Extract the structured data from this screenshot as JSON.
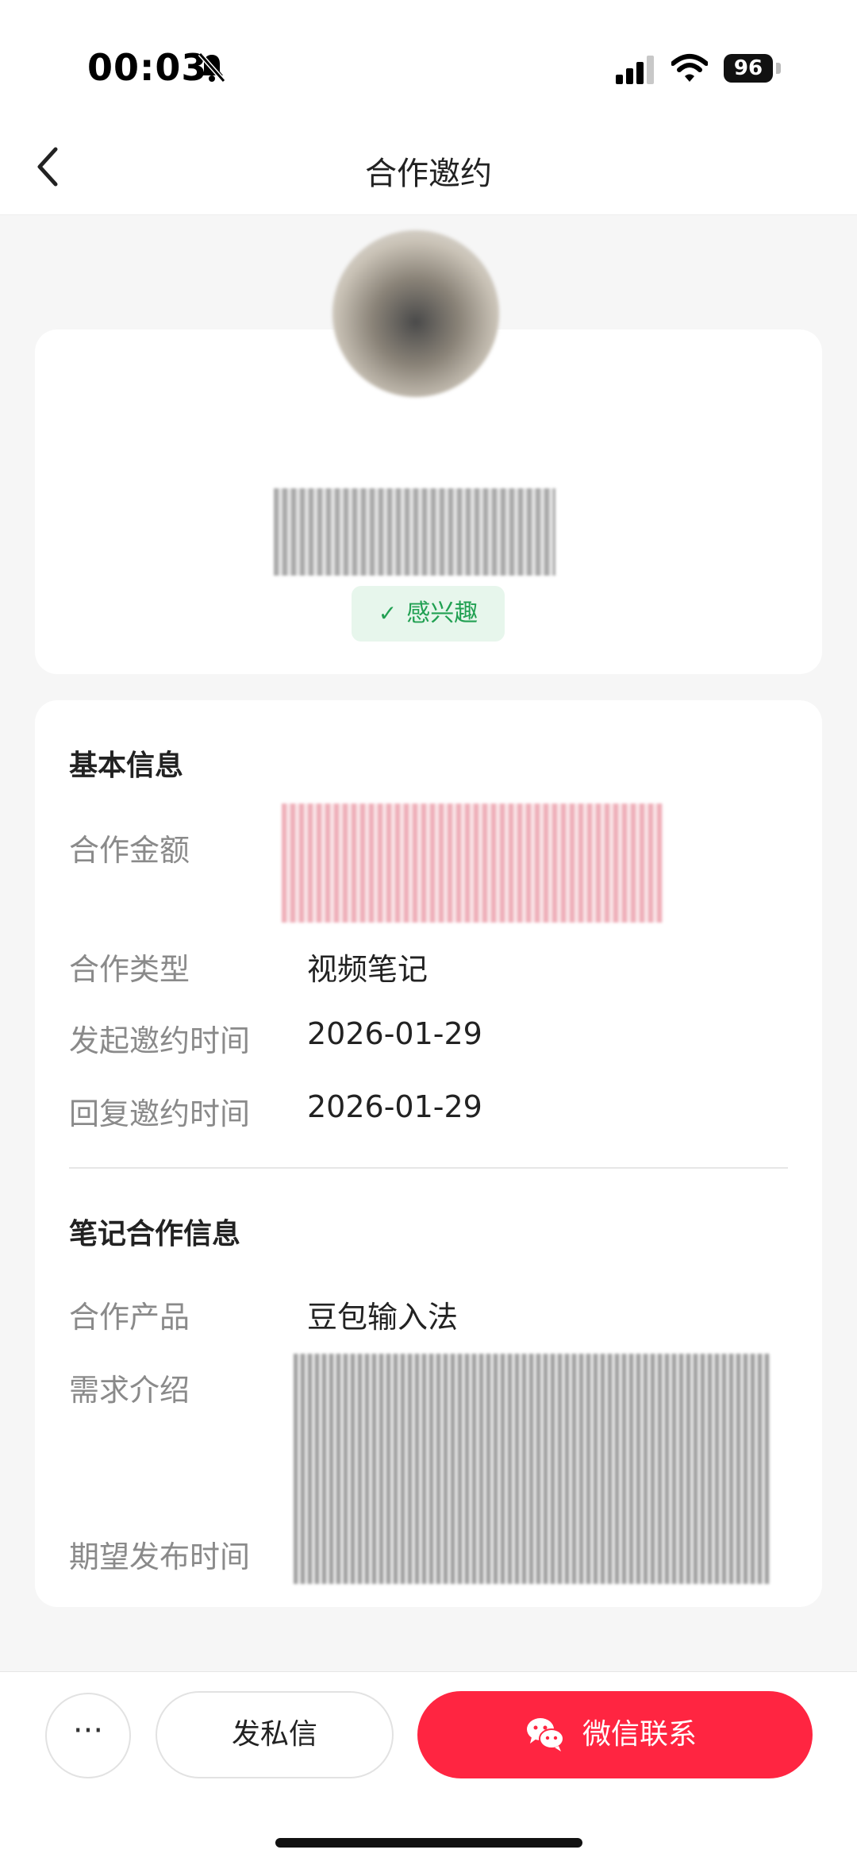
{
  "status_bar": {
    "time": "00:03",
    "battery": "96",
    "icons": [
      "bell-off-icon",
      "signal-icon",
      "wifi-icon",
      "battery-icon"
    ]
  },
  "nav": {
    "title": "合作邀约",
    "back_icon": "chevron-left-icon"
  },
  "profile": {
    "tag_icon": "check-icon",
    "tag_label": "感兴趣"
  },
  "basic_info": {
    "section_title": "基本信息",
    "rows": [
      {
        "label": "合作金额",
        "value": ""
      },
      {
        "label": "合作类型",
        "value": "视频笔记"
      },
      {
        "label": "发起邀约时间",
        "value": "2026-01-29"
      },
      {
        "label": "回复邀约时间",
        "value": "2026-01-29"
      }
    ]
  },
  "note_info": {
    "section_title": "笔记合作信息",
    "rows": [
      {
        "label": "合作产品",
        "value": "豆包输入法"
      },
      {
        "label": "需求介绍",
        "value": ""
      },
      {
        "label": "期望发布时间",
        "value": ""
      }
    ]
  },
  "bottom_bar": {
    "more_label": "···",
    "message_label": "发私信",
    "wechat_label": "微信联系",
    "wechat_icon": "wechat-icon",
    "accent_color": "#ff2541"
  },
  "colors": {
    "tag_green": "#21a052",
    "tag_bg": "#e7f6ec",
    "label_gray": "#8a8a8a"
  }
}
